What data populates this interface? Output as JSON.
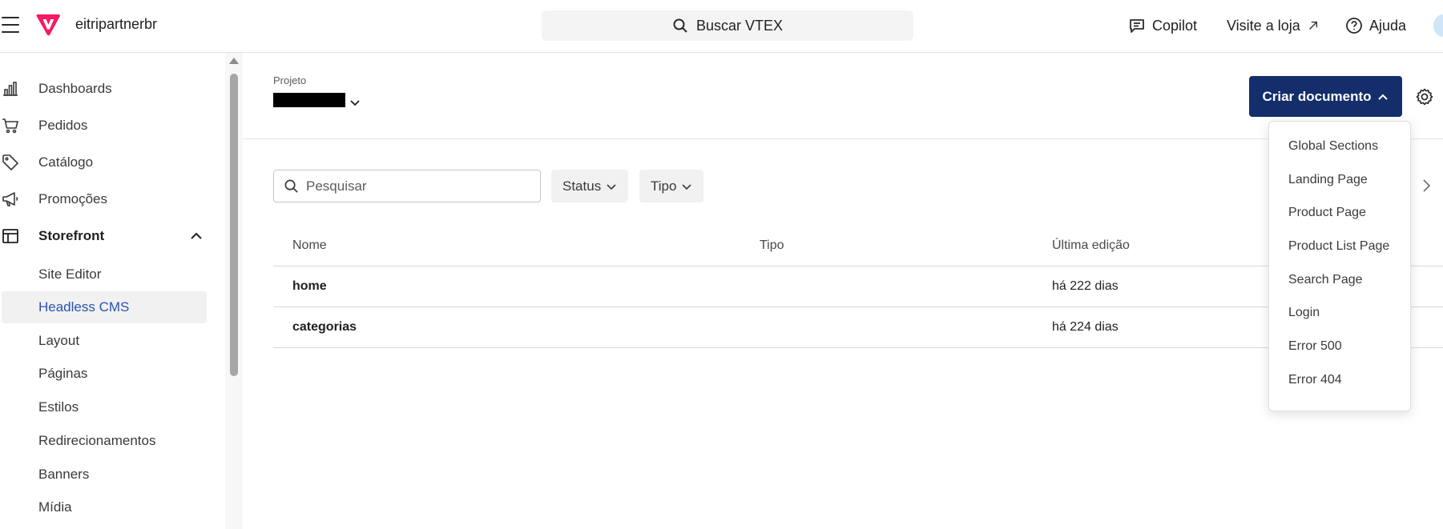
{
  "topbar": {
    "account_name": "eitripartnerbr",
    "search_label": "Buscar VTEX",
    "copilot_label": "Copilot",
    "visit_store_label": "Visite a loja",
    "help_label": "Ajuda",
    "brand_color": "#f71963"
  },
  "sidebar": {
    "items": [
      {
        "label": "Dashboards",
        "icon": "bar-chart-icon"
      },
      {
        "label": "Pedidos",
        "icon": "cart-icon"
      },
      {
        "label": "Catálogo",
        "icon": "tag-icon"
      },
      {
        "label": "Promoções",
        "icon": "megaphone-icon"
      },
      {
        "label": "Storefront",
        "icon": "layout-icon",
        "expanded": true
      }
    ],
    "storefront_children": [
      {
        "label": "Site Editor"
      },
      {
        "label": "Headless CMS",
        "active": true
      },
      {
        "label": "Layout"
      },
      {
        "label": "Páginas"
      },
      {
        "label": "Estilos"
      },
      {
        "label": "Redirecionamentos"
      },
      {
        "label": "Banners"
      },
      {
        "label": "Mídia"
      }
    ],
    "active_color": "#2953b2"
  },
  "main": {
    "project_label": "Projeto",
    "create_button_label": "Criar documento",
    "create_button_color": "#142e6b",
    "filter": {
      "search_placeholder": "Pesquisar",
      "status_label": "Status",
      "type_label": "Tipo"
    },
    "table": {
      "columns": [
        "Nome",
        "Tipo",
        "Última edição"
      ],
      "rows": [
        {
          "name": "home",
          "type": "",
          "edited": "há 222 dias"
        },
        {
          "name": "categorias",
          "type": "",
          "edited": "há 224 dias"
        }
      ]
    },
    "create_menu": {
      "items": [
        "Global Sections",
        "Landing Page",
        "Product Page",
        "Product List Page",
        "Search Page",
        "Login",
        "Error 500",
        "Error 404"
      ]
    }
  }
}
